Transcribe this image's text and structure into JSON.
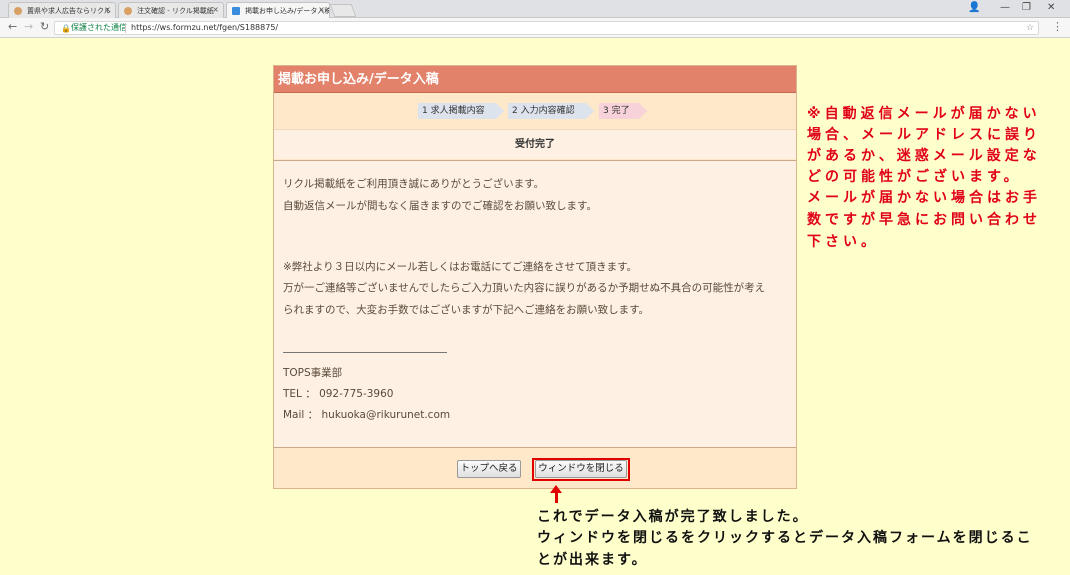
{
  "browser": {
    "tabs": [
      {
        "label": "置県や求人広告ならリクル",
        "close": "×"
      },
      {
        "label": "注文確認 - リクル掲載紙",
        "close": "×"
      },
      {
        "label": "掲載お申し込み/データ入稿",
        "close": "×"
      }
    ],
    "secure_label": "保護された通信",
    "url": "https://ws.formzu.net/fgen/S188875/"
  },
  "form": {
    "title": "掲載お申し込み/データ入稿",
    "steps": [
      "1 求人掲載内容",
      "2 入力内容確認",
      "3 完了"
    ],
    "status": "受付完了",
    "message_lines": [
      "リクル掲載紙をご利用頂き誠にありがとうございます。",
      "自動返信メールが間もなく届きますのでご確認をお願い致します。",
      "※弊社より３日以内にメール若しくはお電話にてご連絡をさせて頂きます。",
      "万が一ご連絡等ございませんでしたらご入力頂いた内容に誤りがあるか予期せぬ不具合の可能性が考え",
      "られますので、大変お手数ではございますが下記へご連絡をお願い致します。"
    ],
    "contact": {
      "dept": "TOPS事業部",
      "tel": "TEL ： 092-775-3960",
      "mail": "Mail ： hukuoka@rikurunet.com"
    },
    "buttons": {
      "top": "トップへ戻る",
      "close": "ウィンドウを閉じる"
    }
  },
  "annotations": {
    "note_lines": [
      "※自動返信メールが届かない",
      "場合、メールアドレスに誤り",
      "があるか、迷惑メール設定な",
      "どの可能性がございます。",
      "メールが届かない場合はお手",
      "数ですが早急にお問い合わせ",
      "下さい。"
    ],
    "caption_lines": [
      "これでデータ入稿が完了致しました。",
      "ウィンドウを閉じるをクリックするとデータ入稿フォームを閉じるこ",
      "とが出来ます。"
    ]
  },
  "colors": {
    "page_bg": "#ffffcc",
    "header": "#e2826a",
    "note": "#e0001a",
    "highlight": "#e00000"
  }
}
